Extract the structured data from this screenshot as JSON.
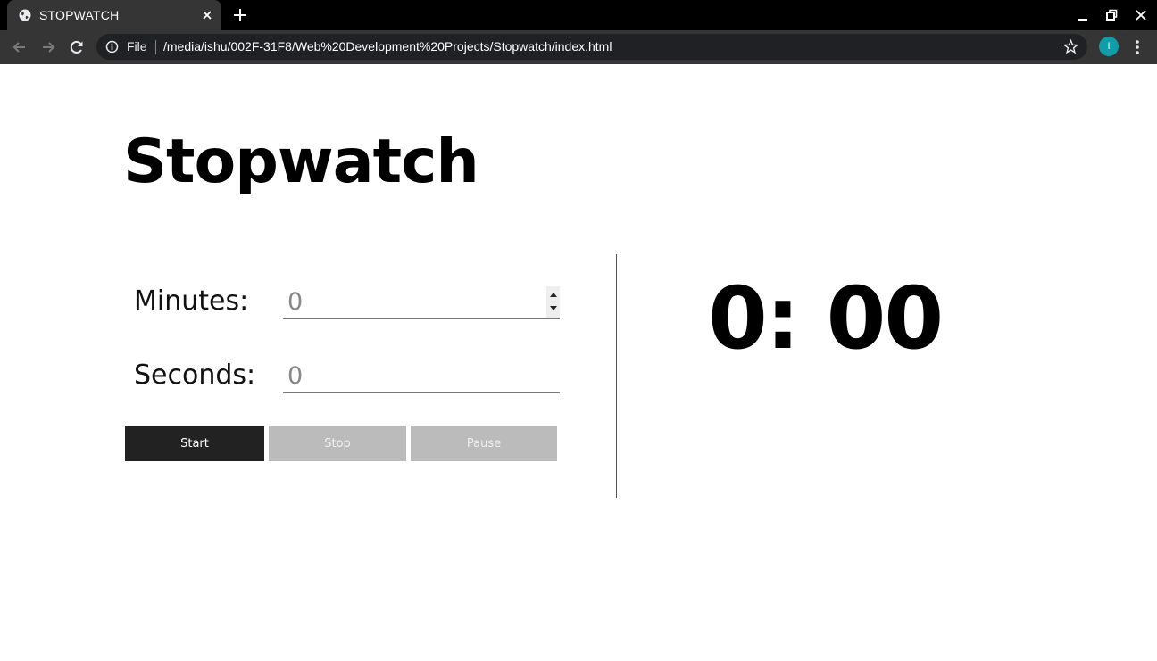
{
  "browser": {
    "tab_title": "STOPWATCH",
    "omnibox_file_label": "File",
    "url": "/media/ishu/002F-31F8/Web%20Development%20Projects/Stopwatch/index.html",
    "profile_initial": "I",
    "profile_color": "#0d9eaa"
  },
  "page": {
    "title": "Stopwatch",
    "minutes_label": "Minutes:",
    "minutes_placeholder": "0",
    "seconds_label": "Seconds:",
    "seconds_placeholder": "0",
    "start_label": "Start",
    "stop_label": "Stop",
    "pause_label": "Pause",
    "timer_display": "0: 00"
  },
  "icons": {
    "favicon": "globe-icon",
    "tab_close": "close-icon",
    "new_tab": "plus-icon",
    "back": "arrow-left-icon",
    "forward": "arrow-right-icon",
    "reload": "reload-icon",
    "site_info": "info-icon",
    "bookmark": "star-icon",
    "menu": "kebab-menu-icon"
  },
  "colors": {
    "start_button": "#222222",
    "disabled_button": "#bbbbbb",
    "accent_avatar": "#0d9eaa"
  }
}
